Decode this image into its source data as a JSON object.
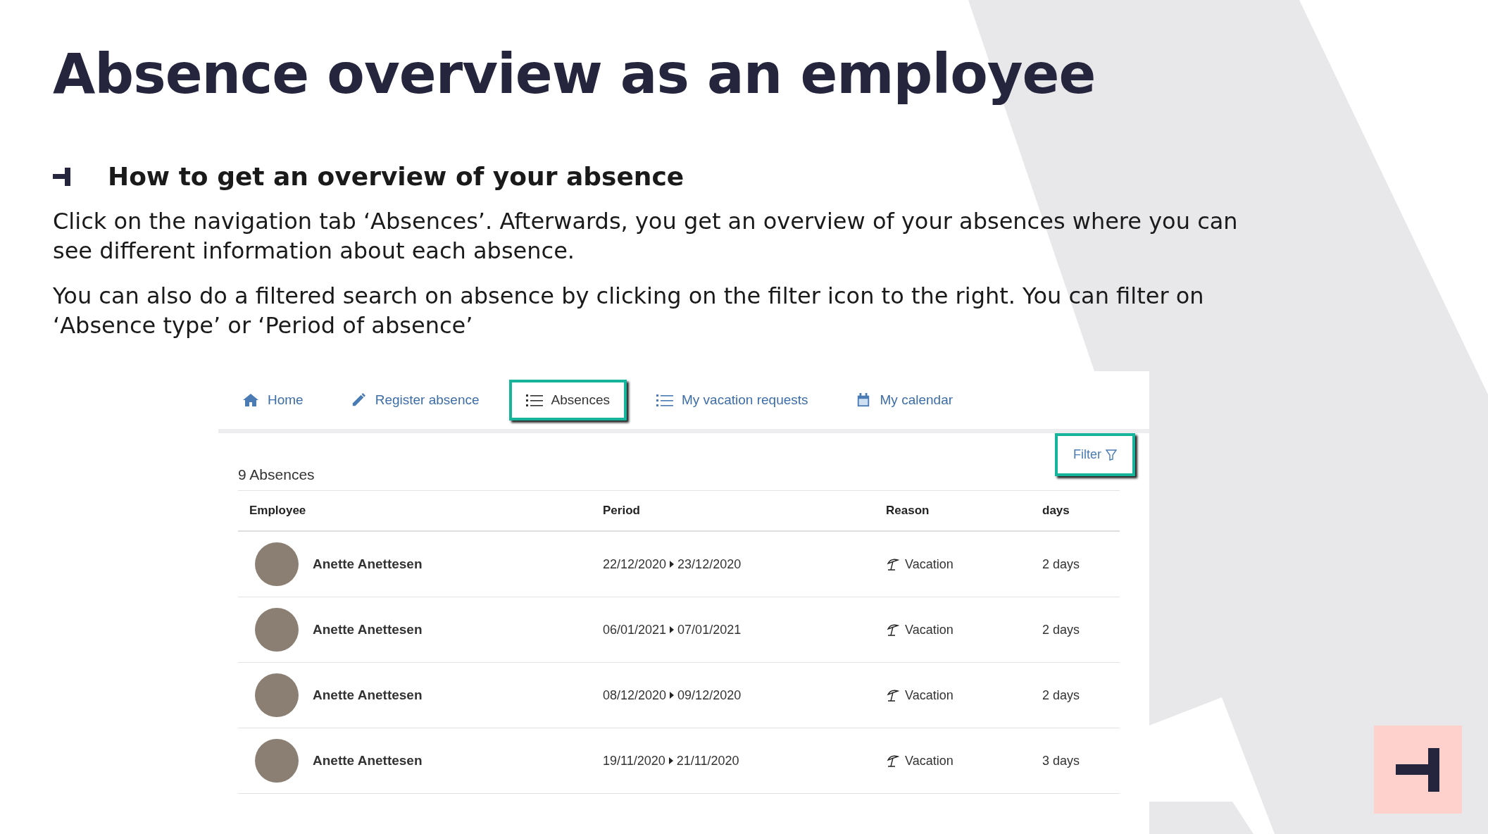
{
  "slide": {
    "title": "Absence overview as an employee",
    "heading": "How to get an overview of your absence",
    "paragraphs": [
      "Click on the navigation tab ‘Absences’. Afterwards, you get an overview of your absences where you can see different information about each absence.",
      "You can also do a filtered search on absence by clicking on the filter icon to the right. You can filter on ‘Absence type’ or ‘Period of absence’"
    ]
  },
  "app": {
    "tabs": [
      {
        "label": "Home",
        "kind": "home",
        "selected": false
      },
      {
        "label": "Register absence",
        "kind": "pencil",
        "selected": false
      },
      {
        "label": "Absences",
        "kind": "list",
        "selected": true
      },
      {
        "label": "My vacation requests",
        "kind": "list",
        "selected": false
      },
      {
        "label": "My calendar",
        "kind": "calendar",
        "selected": false
      }
    ],
    "filter": {
      "label": "Filter",
      "highlighted": true
    },
    "count": "9 Absences",
    "table": {
      "columns": [
        "Employee",
        "Period",
        "Reason",
        "days"
      ],
      "rows": [
        {
          "employee": "Anette Anettesen",
          "start": "22/12/2020",
          "end": "23/12/2020",
          "reason": "Vacation",
          "days": "2 days"
        },
        {
          "employee": "Anette Anettesen",
          "start": "06/01/2021",
          "end": "07/01/2021",
          "reason": "Vacation",
          "days": "2 days"
        },
        {
          "employee": "Anette Anettesen",
          "start": "08/12/2020",
          "end": "09/12/2020",
          "reason": "Vacation",
          "days": "2 days"
        },
        {
          "employee": "Anette Anettesen",
          "start": "19/11/2020",
          "end": "21/11/2020",
          "reason": "Vacation",
          "days": "3 days"
        }
      ]
    }
  }
}
